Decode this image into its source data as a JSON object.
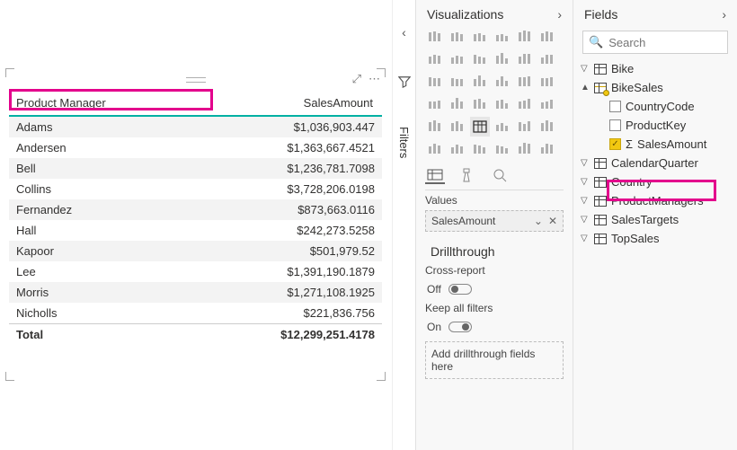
{
  "visual": {
    "columns": [
      "Product Manager",
      "SalesAmount"
    ],
    "rows": [
      {
        "name": "Adams",
        "value": "$1,036,903.447"
      },
      {
        "name": "Andersen",
        "value": "$1,363,667.4521"
      },
      {
        "name": "Bell",
        "value": "$1,236,781.7098"
      },
      {
        "name": "Collins",
        "value": "$3,728,206.0198"
      },
      {
        "name": "Fernandez",
        "value": "$873,663.0116"
      },
      {
        "name": "Hall",
        "value": "$242,273.5258"
      },
      {
        "name": "Kapoor",
        "value": "$501,979.52"
      },
      {
        "name": "Lee",
        "value": "$1,391,190.1879"
      },
      {
        "name": "Morris",
        "value": "$1,271,108.1925"
      },
      {
        "name": "Nicholls",
        "value": "$221,836.756"
      }
    ],
    "total_label": "Total",
    "total_value": "$12,299,251.4178"
  },
  "filters": {
    "label": "Filters"
  },
  "viz_pane": {
    "title": "Visualizations",
    "values_label": "Values",
    "well_field": "SalesAmount",
    "drill": {
      "title": "Drillthrough",
      "cross_label": "Cross-report",
      "cross_state": "Off",
      "keep_label": "Keep all filters",
      "keep_state": "On",
      "drop_text": "Add drillthrough fields here"
    }
  },
  "fields_pane": {
    "title": "Fields",
    "search_placeholder": "Search",
    "tables": {
      "bike": "Bike",
      "bikesales": "BikeSales",
      "countrycode": "CountryCode",
      "productkey": "ProductKey",
      "salesamount": "SalesAmount",
      "calendarquarter": "CalendarQuarter",
      "country": "Country",
      "productmanagers": "ProductManagers",
      "salestargets": "SalesTargets",
      "topsales": "TopSales"
    }
  }
}
